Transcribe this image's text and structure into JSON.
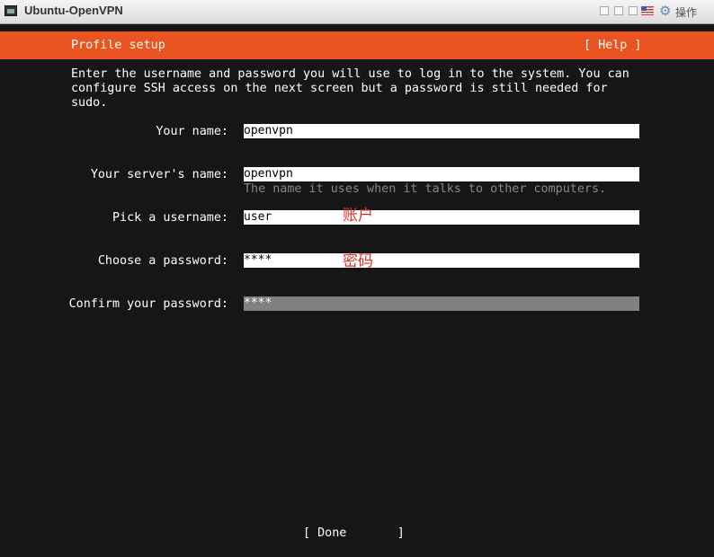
{
  "window": {
    "title": "Ubuntu-OpenVPN",
    "actions_label": "操作"
  },
  "header": {
    "title": "Profile setup",
    "help": "[ Help ]"
  },
  "intro": "Enter the username and password you will use to log in to the system. You can configure SSH access on the next screen but a password is still needed for sudo.",
  "form": {
    "name": {
      "label": "Your name:",
      "value": "openvpn"
    },
    "server_name": {
      "label": "Your server's name:",
      "value": "openvpn",
      "hint": "The name it uses when it talks to other computers."
    },
    "username": {
      "label": "Pick a username:",
      "value": "user"
    },
    "password": {
      "label": "Choose a password:",
      "value": "****"
    },
    "confirm": {
      "label": "Confirm your password:",
      "value": "****"
    }
  },
  "annotations": {
    "account": "账户",
    "password": "密码"
  },
  "done_button": "[ Done       ]",
  "colors": {
    "accent": "#e95420",
    "annotation": "#e0322a",
    "background": "#161616"
  }
}
